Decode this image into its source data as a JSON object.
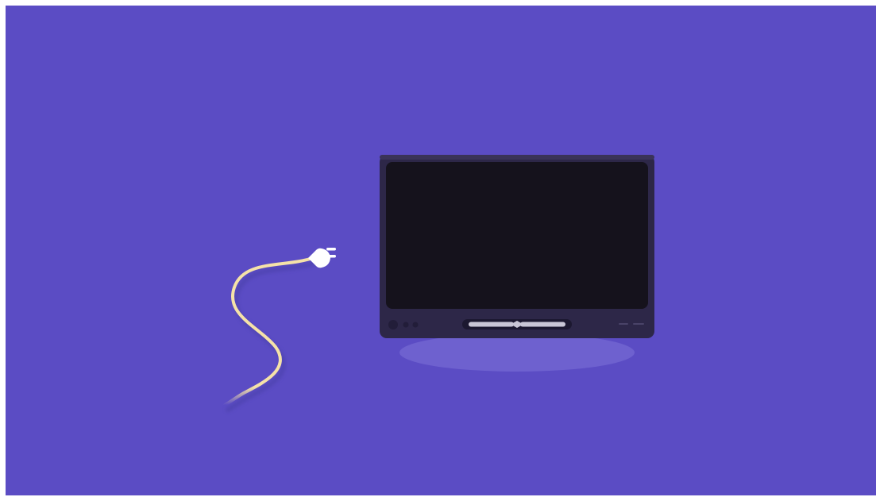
{
  "scene": {
    "background_color": "#5b4cc4",
    "device": {
      "icon_name": "tv-icon",
      "bezel_color": "#2d2748",
      "screen_color": "#15121c",
      "slot_color": "#1c1830",
      "slot_bar_color": "#c9c6d6",
      "shadow_color": "#6e61cf"
    },
    "cable": {
      "icon_name": "unplugged-cable-icon",
      "cord_color": "#f5e2a8",
      "plug_color": "#ffffff"
    }
  }
}
